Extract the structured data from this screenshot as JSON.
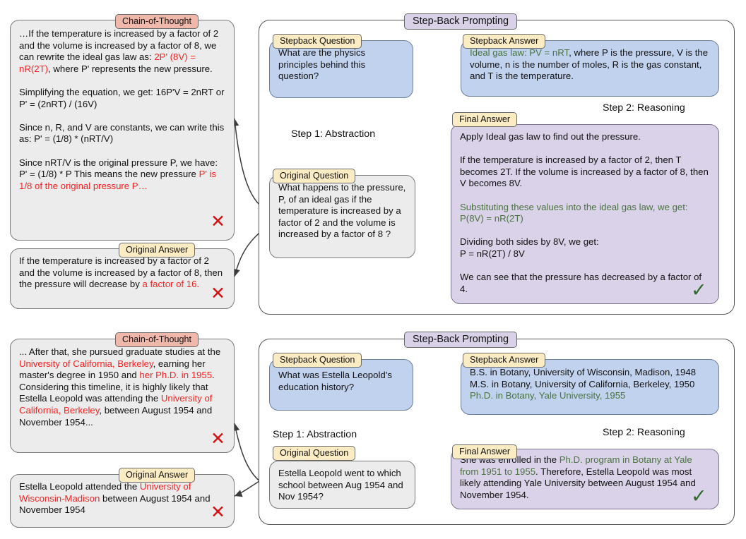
{
  "diagram": {
    "title": "Step-Back Prompting vs Chain-of-Thought comparison",
    "colors": {
      "cot_tag": "#f0b7ab",
      "label_tag": "#fcecc4",
      "stepback_tag": "#d8d1e8",
      "question_box": "#ececec",
      "answer_box": "#c0d2ee",
      "final_box": "#dad2e8",
      "error_red": "#f52424",
      "highlight_green": "#4a7340",
      "abstraction_arrow": "#c3d4ee",
      "reasoning_arrow": "#d9d1e8",
      "blue_arrow": "#4a79c7",
      "purple_arrow": "#b145e0"
    }
  },
  "examples": [
    {
      "id": "physics",
      "left": {
        "cot_tag": "Chain-of-Thought",
        "cot_segments": [
          {
            "text": "…If the temperature is increased by a factor of 2 and the volume is increased by a factor of 8, we can rewrite the ideal gas law as: ",
            "color": "black"
          },
          {
            "text": "2P' (8V) = nR(2T)",
            "color": "red"
          },
          {
            "text": ", where P' represents the new pressure.\n\nSimplifying the equation, we get: 16P'V = 2nRT or P' = (2nRT) / (16V)\n\nSince n, R, and V are constants, we can write this as: P' = (1/8) * (nRT/V)\n\nSince nRT/V is the original pressure P, we have: P' = (1/8) * P This means the new pressure ",
            "color": "black"
          },
          {
            "text": "P' is 1/8 of the original pressure P…",
            "color": "red"
          }
        ],
        "cot_mark": "✕",
        "answer_tag": "Original Answer",
        "answer_segments": [
          {
            "text": "If the temperature is increased by a factor of 2 and the volume is increased by a factor of 8, then the pressure will decrease by ",
            "color": "black"
          },
          {
            "text": "a factor of 16.",
            "color": "red"
          }
        ],
        "answer_mark": "✕"
      },
      "right": {
        "panel_tag": "Step-Back Prompting",
        "stepback_question_tag": "Stepback Question",
        "stepback_question": "What are the physics principles behind this question?",
        "stepback_answer_tag": "Stepback Answer",
        "stepback_answer_segments": [
          {
            "text": "Ideal gas law: PV = nRT",
            "color": "green"
          },
          {
            "text": ", where P is the pressure, V is the volume, n is the number of moles, R is the gas constant, and T is the temperature.",
            "color": "black"
          }
        ],
        "original_question_tag": "Original Question",
        "original_question": "What happens to the pressure, P, of an ideal gas if the temperature is increased by a factor of 2 and the volume is increased by a factor of 8 ?",
        "final_answer_tag": "Final Answer",
        "final_answer_segments": [
          {
            "text": "Apply Ideal gas law to find out the pressure.\n\nIf the temperature is increased by a factor of 2, then T becomes 2T. If the volume is increased by a factor of 8, then V becomes 8V.\n\n",
            "color": "black"
          },
          {
            "text": "Substituting these values into the ideal gas law, we get:\nP(8V) = nR(2T)",
            "color": "green"
          },
          {
            "text": "\n\nDividing both sides by 8V, we get:\nP = nR(2T) / 8V\n\nWe can see that the pressure has decreased by a factor of 4.",
            "color": "black"
          }
        ],
        "final_mark": "✓",
        "step1_label": "Step 1: Abstraction",
        "step2_label": "Step 2: Reasoning"
      }
    },
    {
      "id": "leopold",
      "left": {
        "cot_tag": "Chain-of-Thought",
        "cot_segments": [
          {
            "text": "... After that, she pursued graduate studies at the ",
            "color": "black"
          },
          {
            "text": "University of California, Berkeley",
            "color": "red"
          },
          {
            "text": ", earning her master's degree in 1950 and ",
            "color": "black"
          },
          {
            "text": "her Ph.D. in 1955",
            "color": "red"
          },
          {
            "text": ".\nConsidering this timeline, it is highly likely that Estella Leopold was attending the ",
            "color": "black"
          },
          {
            "text": "University of California, Berkeley",
            "color": "red"
          },
          {
            "text": ", between August 1954 and November 1954...",
            "color": "black"
          }
        ],
        "cot_mark": "✕",
        "answer_tag": "Original Answer",
        "answer_segments": [
          {
            "text": "Estella Leopold attended the ",
            "color": "black"
          },
          {
            "text": "University of Wisconsin-Madison",
            "color": "red"
          },
          {
            "text": " between August 1954 and November 1954",
            "color": "black"
          }
        ],
        "answer_mark": "✕"
      },
      "right": {
        "panel_tag": "Step-Back Prompting",
        "stepback_question_tag": "Stepback Question",
        "stepback_question": "What was Estella Leopold’s education history?",
        "stepback_answer_tag": "Stepback Answer",
        "stepback_answer_segments": [
          {
            "text": "B.S. in Botany, University of Wisconsin, Madison, 1948\nM.S. in Botany, University of California, Berkeley, 1950\n",
            "color": "black"
          },
          {
            "text": "Ph.D. in Botany, Yale University, 1955",
            "color": "green"
          }
        ],
        "original_question_tag": "Original Question",
        "original_question": "Estella Leopold went to which school between Aug 1954 and Nov 1954?",
        "final_answer_tag": "Final Answer",
        "final_answer_segments": [
          {
            "text": "She was enrolled in the ",
            "color": "black"
          },
          {
            "text": "Ph.D. program in Botany at Yale from 1951 to 1955",
            "color": "green"
          },
          {
            "text": ". Therefore, Estella Leopold was most likely attending Yale University between August 1954 and November 1954.",
            "color": "black"
          }
        ],
        "final_mark": "✓",
        "step1_label": "Step 1: Abstraction",
        "step2_label": "Step 2: Reasoning"
      }
    }
  ]
}
